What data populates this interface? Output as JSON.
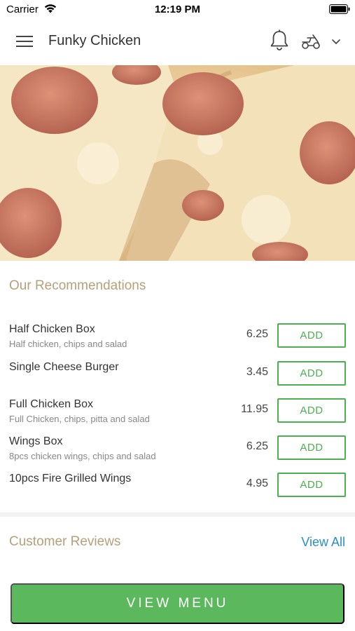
{
  "status_bar": {
    "carrier": "Carrier",
    "time": "12:19 PM",
    "wifi_icon": "wifi-icon",
    "battery_icon": "battery-icon"
  },
  "header": {
    "title": "Funky Chicken",
    "menu_icon": "hamburger-menu-icon",
    "notification_icon": "bell-icon",
    "delivery_icon": "scooter-icon",
    "dropdown_icon": "chevron-down-icon"
  },
  "hero": {
    "image": "pepperoni-pizza-photo"
  },
  "recommendations": {
    "title": "Our Recommendations",
    "items": [
      {
        "name": "Half Chicken Box",
        "description": "Half chicken, chips and salad",
        "price": "6.25",
        "button": "ADD"
      },
      {
        "name": "Single Cheese Burger",
        "description": "",
        "price": "3.45",
        "button": "ADD"
      },
      {
        "name": "Full Chicken Box",
        "description": "Full Chicken, chips, pitta and salad",
        "price": "11.95",
        "button": "ADD"
      },
      {
        "name": "Wings Box",
        "description": "8pcs chicken wings, chips and salad",
        "price": "6.25",
        "button": "ADD"
      },
      {
        "name": "10pcs Fire Grilled Wings",
        "description": "",
        "price": "4.95",
        "button": "ADD"
      }
    ]
  },
  "reviews": {
    "title": "Customer Reviews",
    "view_all": "View All"
  },
  "footer": {
    "view_menu": "VIEW MENU"
  },
  "colors": {
    "accent_green": "#5cb85c",
    "section_title": "#b5a07a",
    "link_blue": "#2a8fc9"
  }
}
